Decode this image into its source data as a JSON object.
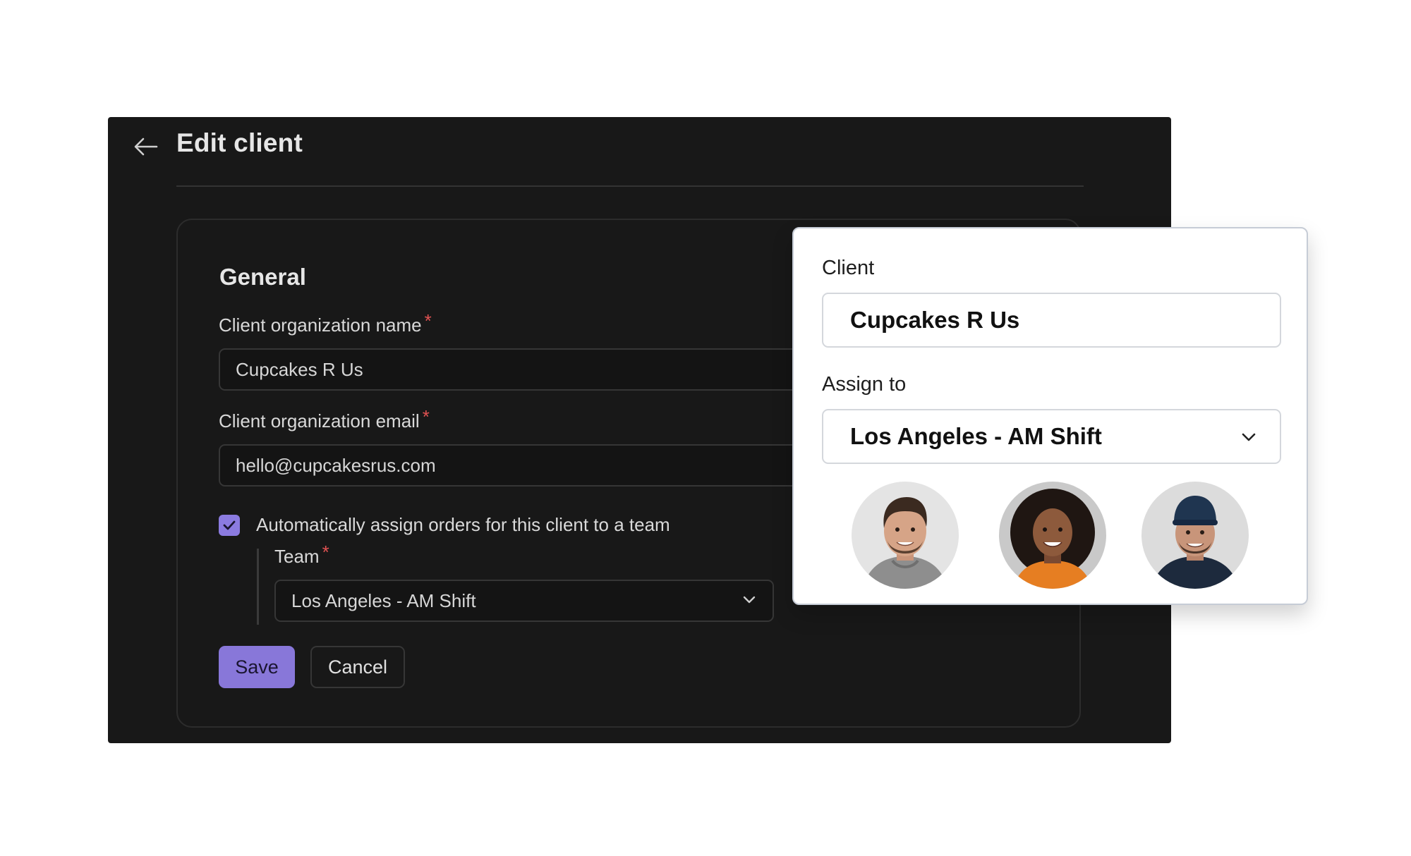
{
  "header": {
    "title": "Edit client"
  },
  "form": {
    "section_title": "General",
    "name_label": "Client organization name",
    "name_value": "Cupcakes R Us",
    "email_label": "Client organization email",
    "email_value": "hello@cupcakesrus.com",
    "auto_assign_label": "Automatically assign orders for this client to a team",
    "auto_assign_checked": true,
    "team_label": "Team",
    "team_value": "Los Angeles - AM Shift",
    "required_mark": "*",
    "save_label": "Save",
    "cancel_label": "Cancel"
  },
  "popup": {
    "client_label": "Client",
    "client_value": "Cupcakes R Us",
    "assign_label": "Assign to",
    "assign_value": "Los Angeles - AM Shift",
    "avatars": [
      {
        "name": "avatar-man-gray-shirt"
      },
      {
        "name": "avatar-woman-orange-shirt"
      },
      {
        "name": "avatar-man-blue-cap"
      }
    ]
  },
  "colors": {
    "panel_bg": "#181818",
    "accent": "#8877d9",
    "required": "#e05252"
  },
  "icons": [
    "back-arrow-icon",
    "check-icon",
    "chevron-down-icon"
  ]
}
